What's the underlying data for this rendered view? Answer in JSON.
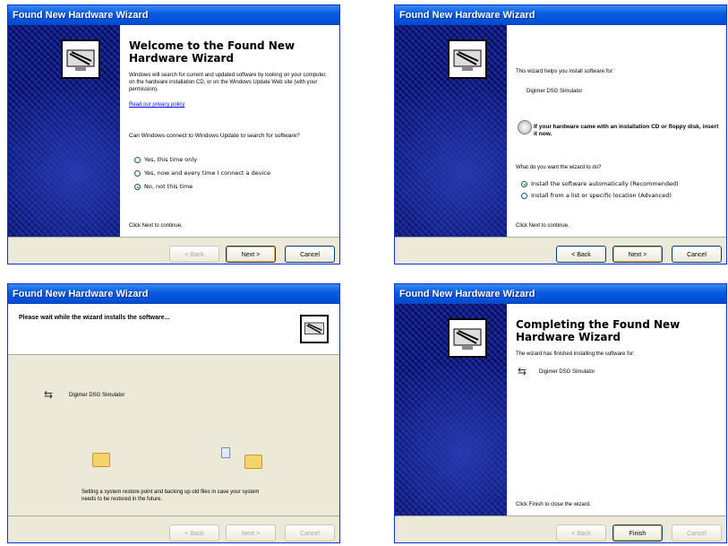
{
  "w1": {
    "title_bar": "Found New Hardware Wizard",
    "heading": "Welcome to the Found New Hardware Wizard",
    "para1": "Windows will search for current and updated software by looking on your computer, on the hardware installation CD, or on the Windows Update Web site (with your permission).",
    "privacy_link": "Read our privacy policy",
    "question": "Can Windows connect to Windows Update to search for software?",
    "options": [
      "Yes, this time only",
      "Yes, now and every time I connect a device",
      "No, not this time"
    ],
    "instruction": "Click Next to continue.",
    "back": "< Back",
    "next": "Next >",
    "cancel": "Cancel"
  },
  "w2": {
    "title_bar": "Found New Hardware Wizard",
    "intro": "This wizard helps you install software for:",
    "device": "Digimer DSG Simulator",
    "cd_text": "If your hardware came with an installation CD or floppy disk, insert it now.",
    "question": "What do you want the wizard to do?",
    "options": [
      "Install the software automatically (Recommended)",
      "Install from a list or specific location (Advanced)"
    ],
    "instruction": "Click Next to continue.",
    "back": "< Back",
    "next": "Next >",
    "cancel": "Cancel"
  },
  "w3": {
    "title_bar": "Found New Hardware Wizard",
    "heading": "Please wait while the wizard installs the software...",
    "device": "Digimer DSG Simulator",
    "restore_text": "Setting a system restore point and backing up old files in case your system needs to be restored in the future.",
    "back": "< Back",
    "next": "Next >",
    "cancel": "Cancel"
  },
  "w4": {
    "title_bar": "Found New Hardware Wizard",
    "heading": "Completing the Found New Hardware Wizard",
    "finished_text": "The wizard has finished installing the software for:",
    "device": "Digimer DSG Simulator",
    "instruction": "Click Finish to close the wizard.",
    "back": "< Back",
    "finish": "Finish",
    "cancel": "Cancel"
  }
}
